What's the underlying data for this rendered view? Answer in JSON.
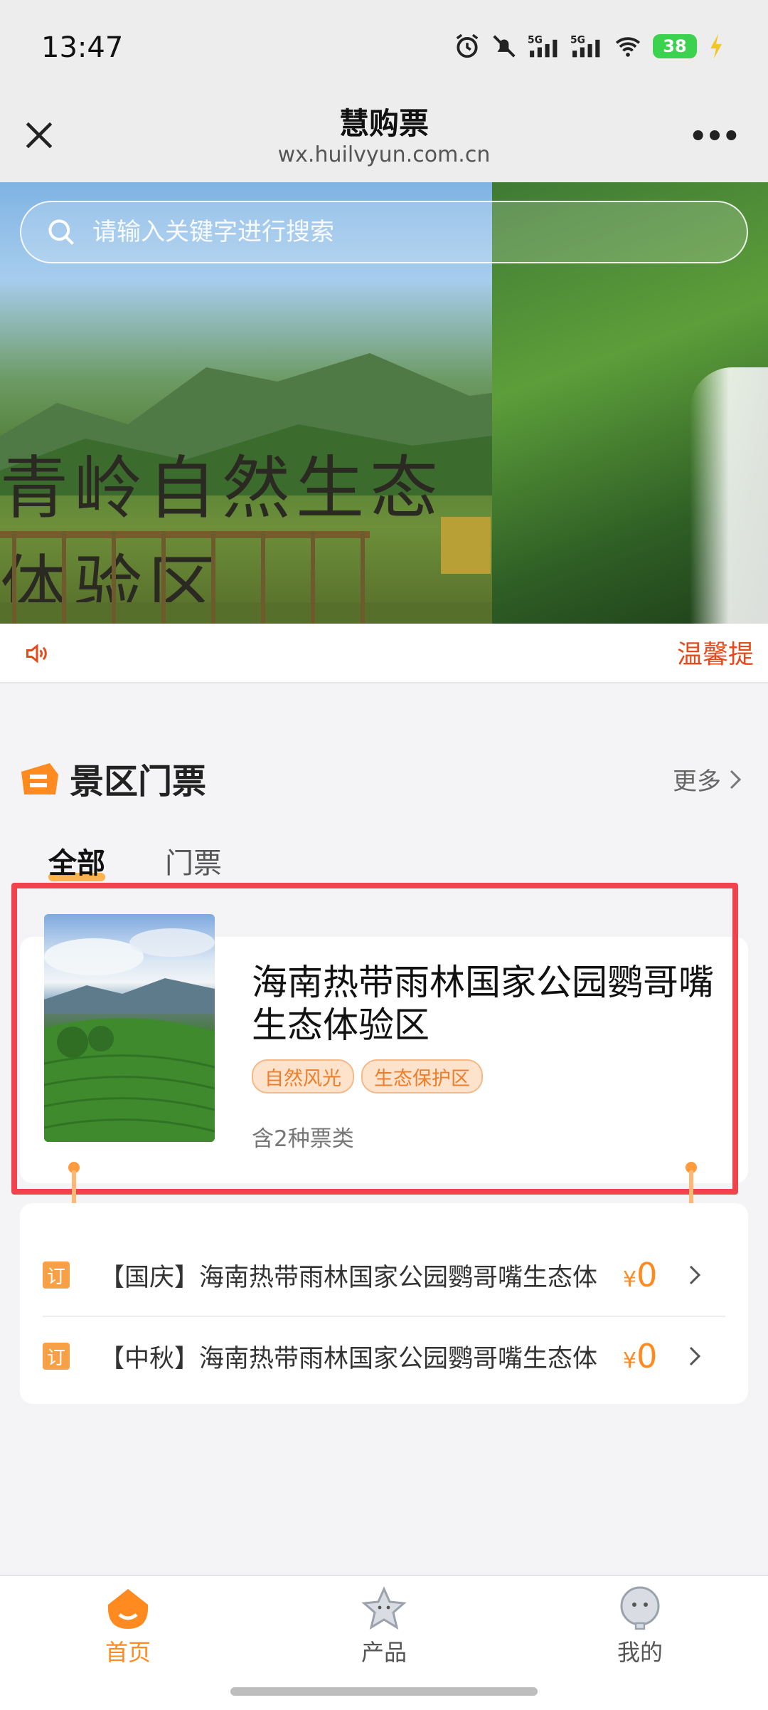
{
  "status": {
    "time": "13:47",
    "battery": "38"
  },
  "header": {
    "title": "慧购票",
    "subtitle": "wx.huilvyun.com.cn"
  },
  "banner": {
    "placeholder": "请输入关键字进行搜索",
    "sign_text": "青岭自然生态体验区"
  },
  "notice": {
    "text": "温馨提"
  },
  "section": {
    "title": "景区门票",
    "more": "更多"
  },
  "tabs": [
    {
      "label": "全部",
      "active": true
    },
    {
      "label": "门票",
      "active": false
    }
  ],
  "product": {
    "title": "海南热带雨林国家公园鹦哥嘴生态体验区",
    "tags": [
      "自然风光",
      "生态保护区"
    ],
    "meta": "含2种票类"
  },
  "tickets": [
    {
      "badge": "订",
      "name": "【国庆】海南热带雨林国家公园鹦哥嘴生态体验区门票",
      "currency": "¥",
      "price": "0"
    },
    {
      "badge": "订",
      "name": "【中秋】海南热带雨林国家公园鹦哥嘴生态体验区门票",
      "currency": "¥",
      "price": "0"
    }
  ],
  "nav": [
    {
      "label": "首页",
      "icon": "home-icon",
      "active": true
    },
    {
      "label": "产品",
      "icon": "star-icon",
      "active": false
    },
    {
      "label": "我的",
      "icon": "profile-icon",
      "active": false
    }
  ],
  "colors": {
    "accent": "#ff8a1f",
    "highlight": "#f0434d",
    "notice": "#e54a1c"
  }
}
